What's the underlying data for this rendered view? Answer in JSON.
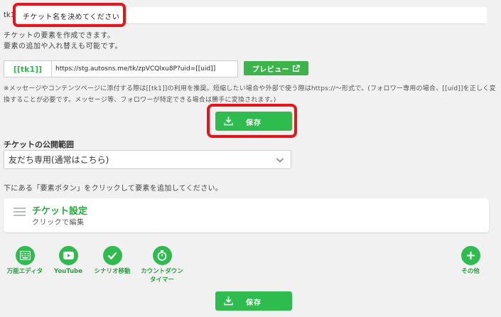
{
  "title_row": {
    "prefix": "tk1",
    "ticket_name_placeholder": "チケット名を決めてください"
  },
  "description": {
    "line1": "チケットの要素を作成できます。",
    "line2": "要素の追加や入れ替えも可能です。"
  },
  "url_row": {
    "tag": "[[tk1]]",
    "url": "https://stg.autosns.me/tk/zpVCQlxu8P?uid=[[uid]]",
    "preview_label": "プレビュー"
  },
  "notice": "※メッセージやコンテンツページに添付する際は[[tk1]]の利用を推奨。短縮したい場合や外部で使う際はhttps://〜形式で。(フォロワー専用の場合、[[uid]]を正しく変換することが必要です。メッセージ等、フォロワーが特定できる場合は勝手に変換されます。)",
  "save_label": "保存",
  "visibility": {
    "label": "チケットの公開範囲",
    "selected": "友だち専用(通常はこちら)"
  },
  "hint": "下にある「要素ボタン」をクリックして要素を追加してください。",
  "settings_card": {
    "title": "チケット設定",
    "subtitle": "クリックで編集"
  },
  "element_buttons": {
    "editor": "万能エディタ",
    "youtube": "YouTube",
    "scenario": "シナリオ移動",
    "countdown_line1": "カウントダウン",
    "countdown_line2": "タイマー",
    "other": "その他"
  },
  "colors": {
    "accent_green": "#2ebc4f",
    "highlight_red": "#e8141c",
    "background": "#f1f1f1"
  }
}
